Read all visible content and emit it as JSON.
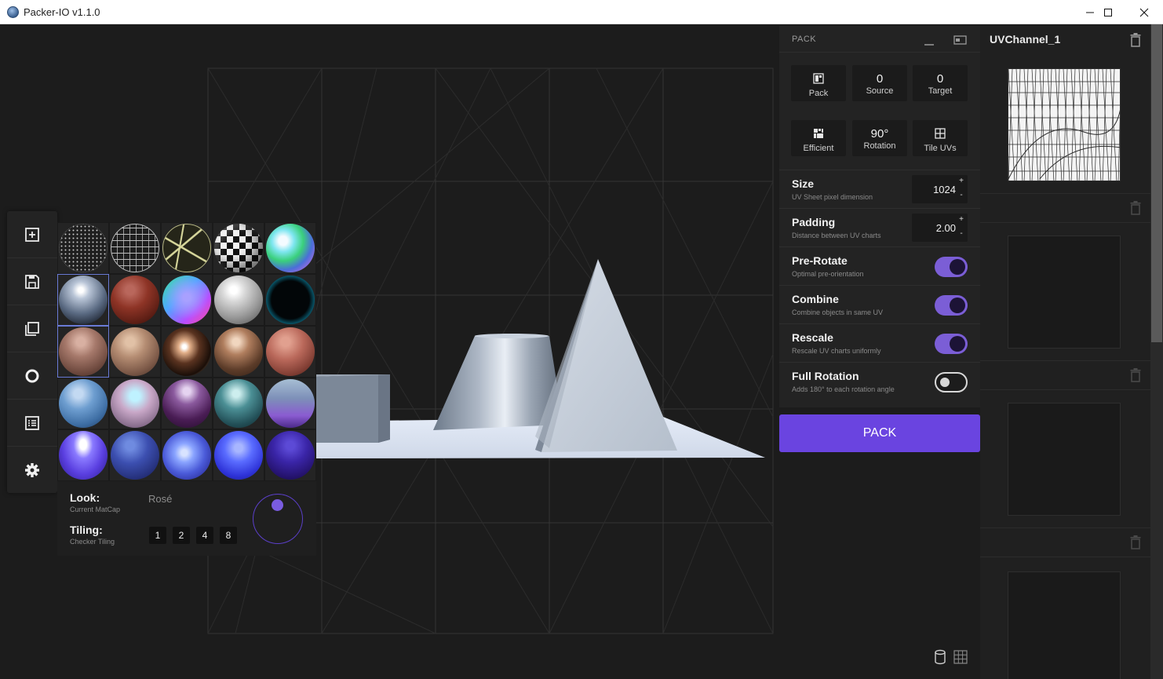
{
  "window": {
    "title": "Packer-IO v1.1.0"
  },
  "pack": {
    "header": "PACK",
    "stats": [
      {
        "value": "",
        "label": "Pack",
        "icon": "pack-icon"
      },
      {
        "value": "0",
        "label": "Source"
      },
      {
        "value": "0",
        "label": "Target"
      },
      {
        "value": "",
        "label": "Efficient",
        "icon": "efficient-icon"
      },
      {
        "value": "90°",
        "label": "Rotation"
      },
      {
        "value": "",
        "label": "Tile UVs",
        "icon": "tile-uvs-icon"
      }
    ],
    "settings": {
      "size": {
        "name": "Size",
        "desc": "UV Sheet pixel dimension",
        "value": "1024"
      },
      "padding": {
        "name": "Padding",
        "desc": "Distance between UV charts",
        "value": "2.00"
      },
      "prerotate": {
        "name": "Pre-Rotate",
        "desc": "Optimal pre-orientation",
        "on": true
      },
      "combine": {
        "name": "Combine",
        "desc": "Combine objects in same UV",
        "on": true
      },
      "rescale": {
        "name": "Rescale",
        "desc": "Rescale UV charts uniformly",
        "on": true
      },
      "fullrotation": {
        "name": "Full Rotation",
        "desc": "Adds 180° to each rotation angle",
        "on": false
      }
    },
    "button_label": "PACK",
    "stepper_plus": "+",
    "stepper_minus": "-"
  },
  "uv_channels": {
    "first_title": "UVChannel_1"
  },
  "matcap": {
    "look_label": "Look:",
    "look_sub": "Current MatCap",
    "look_value": "Rosé",
    "tiling_label": "Tiling:",
    "tiling_sub": "Checker Tiling",
    "tiling_options": [
      "1",
      "2",
      "4",
      "8"
    ]
  },
  "colors": {
    "accent": "#6a44e0",
    "toggle_on": "#7b5ed6"
  }
}
